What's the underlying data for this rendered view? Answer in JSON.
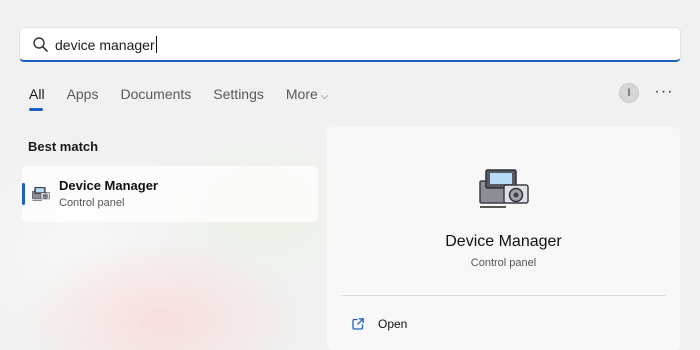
{
  "search": {
    "value": "device manager",
    "icon": "search-icon"
  },
  "tabs": [
    {
      "label": "All",
      "active": true
    },
    {
      "label": "Apps"
    },
    {
      "label": "Documents"
    },
    {
      "label": "Settings"
    },
    {
      "label": "More",
      "has_chevron": true
    }
  ],
  "account": {
    "initial": "I"
  },
  "more_options_label": "···",
  "best_match": {
    "heading": "Best match",
    "result": {
      "title": "Device Manager",
      "subtitle": "Control panel",
      "icon": "device-manager-icon"
    }
  },
  "detail": {
    "title": "Device Manager",
    "subtitle": "Control panel",
    "icon": "device-manager-icon",
    "actions": [
      {
        "label": "Open",
        "icon": "open-external-icon"
      }
    ]
  },
  "colors": {
    "accent": "#1d5fc4"
  }
}
